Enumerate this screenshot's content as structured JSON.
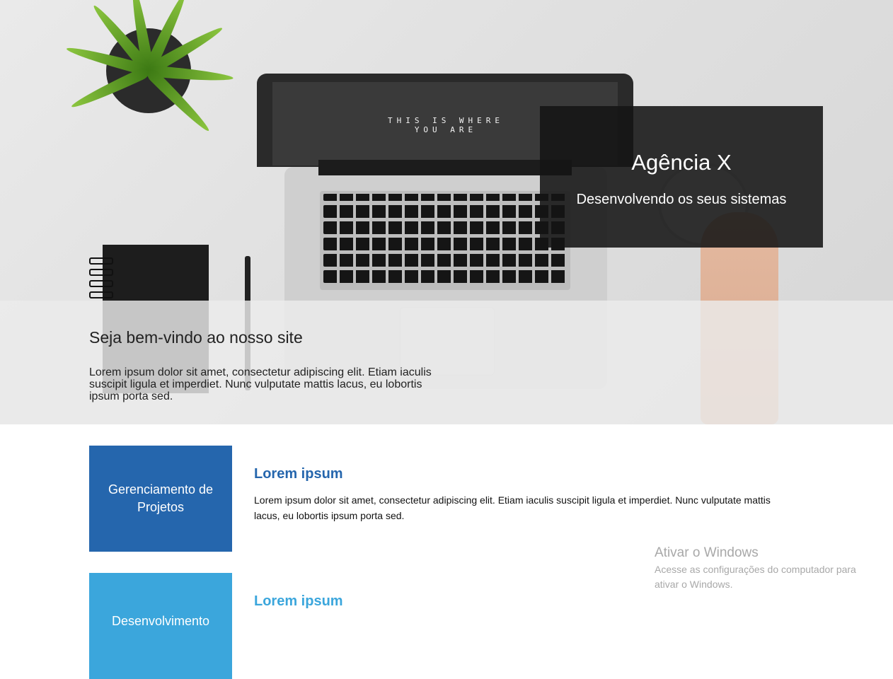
{
  "hero": {
    "screen_text": "THIS IS WHERE YOU ARE",
    "card": {
      "title": "Agência X",
      "subtitle": "Desenvolvendo os seus sistemas"
    }
  },
  "welcome": {
    "title": "Seja bem-vindo ao nosso site",
    "text": "Lorem ipsum dolor sit amet, consectetur adipiscing elit. Etiam iaculis suscipit ligula et imperdiet. Nunc vulputate mattis lacus, eu lobortis ipsum porta sed."
  },
  "services": [
    {
      "label": "Gerenciamento de Projetos",
      "title": "Lorem ipsum",
      "text": "Lorem ipsum dolor sit amet, consectetur adipiscing elit. Etiam iaculis suscipit ligula et imperdiet. Nunc vulputate mattis lacus, eu lobortis ipsum porta sed.",
      "color": "#2566ad"
    },
    {
      "label": "Desenvolvimento",
      "title": "Lorem ipsum",
      "color": "#3ba6dc"
    }
  ],
  "windows_activation": {
    "title": "Ativar o Windows",
    "text": "Acesse as configurações do computador para ativar o Windows."
  }
}
